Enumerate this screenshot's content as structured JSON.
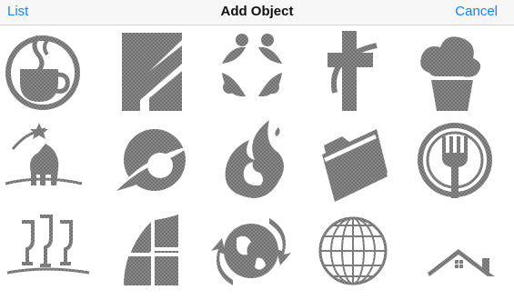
{
  "navbar": {
    "left_label": "List",
    "title": "Add Object",
    "right_label": "Cancel"
  },
  "colors": {
    "accent": "#1a82f7",
    "icon_gray": "#7b7b7b",
    "navbar_bg": "#f7f7f7"
  },
  "objects": [
    {
      "icon": "coffee-cup-icon"
    },
    {
      "icon": "building-columns-icon"
    },
    {
      "icon": "four-people-circle-icon"
    },
    {
      "icon": "church-cross-icon"
    },
    {
      "icon": "cupcake-icon"
    },
    {
      "icon": "bear-icon"
    },
    {
      "icon": "swoosh-circle-icon"
    },
    {
      "icon": "flame-icon"
    },
    {
      "icon": "folder-icon"
    },
    {
      "icon": "fork-plate-icon"
    },
    {
      "icon": "champagne-glasses-icon"
    },
    {
      "icon": "sail-tiles-icon"
    },
    {
      "icon": "globe-arrows-icon"
    },
    {
      "icon": "wireframe-globe-icon"
    },
    {
      "icon": "house-roof-icon"
    }
  ]
}
